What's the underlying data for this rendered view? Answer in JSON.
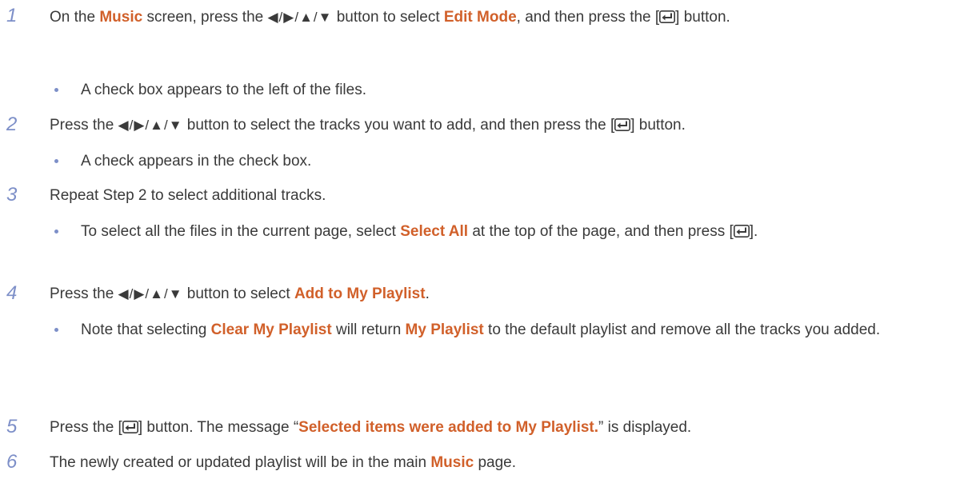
{
  "step_numbers": [
    "1",
    "2",
    "3",
    "4",
    "5",
    "6"
  ],
  "arrows": "◀/▶/▲/▼",
  "icons": {
    "enter": "enter-key-icon",
    "bullet": "bullet-dot"
  },
  "colors": {
    "highlight": "#d1602a",
    "step_number": "#7d8fc8",
    "text": "#3a3a3a"
  },
  "steps": [
    {
      "a": "On the ",
      "b": "Music",
      "c": " screen, press the ",
      "d": " button to select ",
      "e": "Edit Mode",
      "f": ", and then press the [",
      "g": "] button.",
      "bullet": "A check box appears to the left of the files."
    },
    {
      "a": "Press the ",
      "b": " button to select the tracks you want to add, and then press the [",
      "c": "] button.",
      "bullet": "A check appears in the check box."
    },
    {
      "a": "Repeat Step 2 to select additional tracks.",
      "bullet_a": "To select all the files in the current page, select ",
      "bullet_b": "Select All",
      "bullet_c": " at the top of the page, and then press [",
      "bullet_d": "]."
    },
    {
      "a": "Press the ",
      "b": " button to select ",
      "c": "Add to My Playlist",
      "d": ".",
      "bullet_a": "Note that selecting ",
      "bullet_b": "Clear My Playlist",
      "bullet_c": " will return ",
      "bullet_d": "My Playlist",
      "bullet_e": " to the default playlist and remove all the tracks you added."
    },
    {
      "a": "Press the [",
      "b": "] button. The message “",
      "c": "Selected items were added to My Playlist.",
      "d": "” is displayed."
    },
    {
      "a": "The newly created or updated playlist will be in the main ",
      "b": "Music",
      "c": " page."
    }
  ]
}
